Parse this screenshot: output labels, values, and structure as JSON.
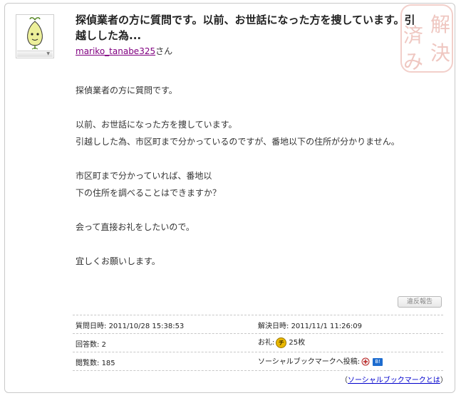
{
  "question": {
    "title": "探偵業者の方に質問です。以前、お世話になった方を捜しています。引越しした為...",
    "asker_name": "mariko_tanabe325",
    "asker_suffix": "さん",
    "stamp_text": [
      "解",
      "決",
      "済",
      "み"
    ],
    "body": [
      "探偵業者の方に質問です。",
      "",
      "以前、お世話になった方を捜しています。",
      "引越しした為、市区町まで分かっているのですが、番地以下の住所が分かりません。",
      "",
      "市区町まで分かっていれば、番地以",
      "下の住所を調べることはできますか？",
      "",
      "会って直接お礼をしたいので。",
      "",
      "宜しくお願いします。"
    ],
    "report_button": "違反報告"
  },
  "info": {
    "asked_label": "質問日時:",
    "asked_value": "2011/10/28 15:38:53",
    "resolved_label": "解決日時:",
    "resolved_value": "2011/11/1 11:26:09",
    "answers_label": "回答数:",
    "answers_value": "2",
    "reward_label": "お礼:",
    "reward_coin": "チ",
    "reward_value": "25枚",
    "views_label": "閲覧数:",
    "views_value": "185",
    "social_label": "ソーシャルブックマークへ投稿:",
    "hatena_label": "B!",
    "social_link_open": "（",
    "social_link_text": "ソーシャルブックマークとは",
    "social_link_close": "）"
  }
}
